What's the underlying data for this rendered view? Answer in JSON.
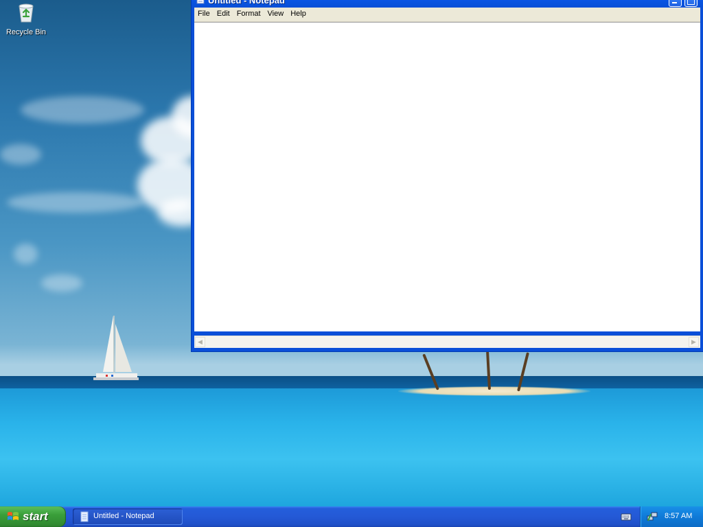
{
  "desktop": {
    "icons": [
      {
        "label": "Recycle Bin",
        "icon": "recycle-bin-icon"
      }
    ]
  },
  "notepad": {
    "title": "Untitled - Notepad",
    "menu": [
      "File",
      "Edit",
      "Format",
      "View",
      "Help"
    ],
    "content": ""
  },
  "taskbar": {
    "start_label": "start",
    "tasks": [
      {
        "label": "Untitled - Notepad",
        "icon": "notepad-icon"
      }
    ],
    "tray": {
      "clock": "8:57 AM"
    }
  },
  "colors": {
    "title_bar": "#0a56e6",
    "taskbar": "#245edb",
    "start_button": "#3a9f3a",
    "tray": "#0f7ad8"
  }
}
